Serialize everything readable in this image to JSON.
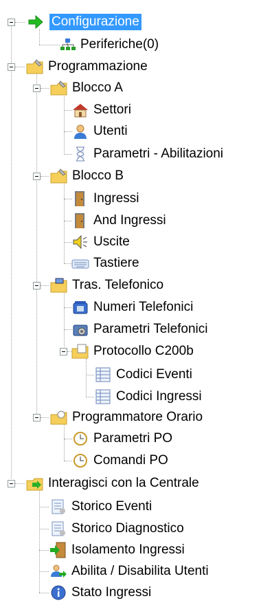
{
  "tree": {
    "configurazione": "Configurazione",
    "periferiche": "Periferiche(0)",
    "programmazione": "Programmazione",
    "blocco_a": "Blocco A",
    "settori": "Settori",
    "utenti": "Utenti",
    "parametri_abilitazioni": "Parametri - Abilitazioni",
    "blocco_b": "Blocco B",
    "ingressi": "Ingressi",
    "and_ingressi": "And Ingressi",
    "uscite": "Uscite",
    "tastiere": "Tastiere",
    "tras_telefonico": "Tras. Telefonico",
    "numeri_telefonici": "Numeri Telefonici",
    "parametri_telefonici": "Parametri Telefonici",
    "protocollo_c200b": "Protocollo C200b",
    "codici_eventi": "Codici Eventi",
    "codici_ingressi": "Codici Ingressi",
    "programmatore_orario": "Programmatore Orario",
    "parametri_po": "Parametri PO",
    "comandi_po": "Comandi PO",
    "interagisci": "Interagisci con la Centrale",
    "storico_eventi": "Storico Eventi",
    "storico_diagnostico": "Storico Diagnostico",
    "isolamento_ingressi": "Isolamento Ingressi",
    "abilita_disabilita_utenti": "Abilita / Disabilita Utenti",
    "stato_ingressi": "Stato Ingressi"
  },
  "colors": {
    "selection": "#3399ff",
    "folder": "#f5cf5a",
    "arrow": "#22bb22"
  }
}
